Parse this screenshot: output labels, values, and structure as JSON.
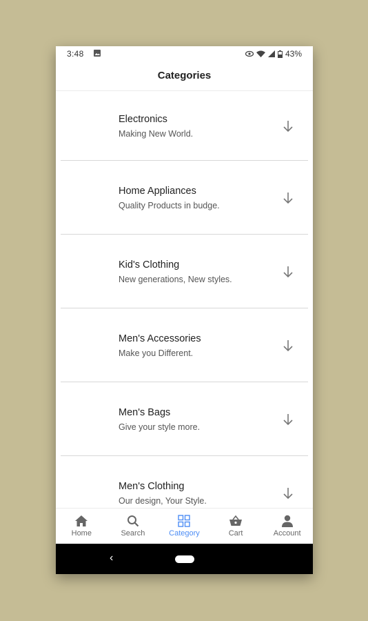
{
  "status_bar": {
    "time": "3:48",
    "battery": "43%"
  },
  "header": {
    "title": "Categories"
  },
  "categories": [
    {
      "name": "Electronics",
      "description": "Making New World."
    },
    {
      "name": "Home Appliances",
      "description": "Quality Products in budge."
    },
    {
      "name": "Kid's Clothing",
      "description": "New generations, New styles."
    },
    {
      "name": "Men's Accessories",
      "description": "Make you Different."
    },
    {
      "name": "Men's Bags",
      "description": "Give your style more."
    },
    {
      "name": "Men's Clothing",
      "description": "Our design, Your Style."
    }
  ],
  "bottom_nav": [
    {
      "label": "Home",
      "icon": "home-icon"
    },
    {
      "label": "Search",
      "icon": "search-icon"
    },
    {
      "label": "Category",
      "icon": "grid-icon",
      "active": true
    },
    {
      "label": "Cart",
      "icon": "basket-icon"
    },
    {
      "label": "Account",
      "icon": "person-icon"
    }
  ],
  "colors": {
    "background": "#c5bc95",
    "accent": "#4d8df5",
    "system_nav": "#000000"
  }
}
